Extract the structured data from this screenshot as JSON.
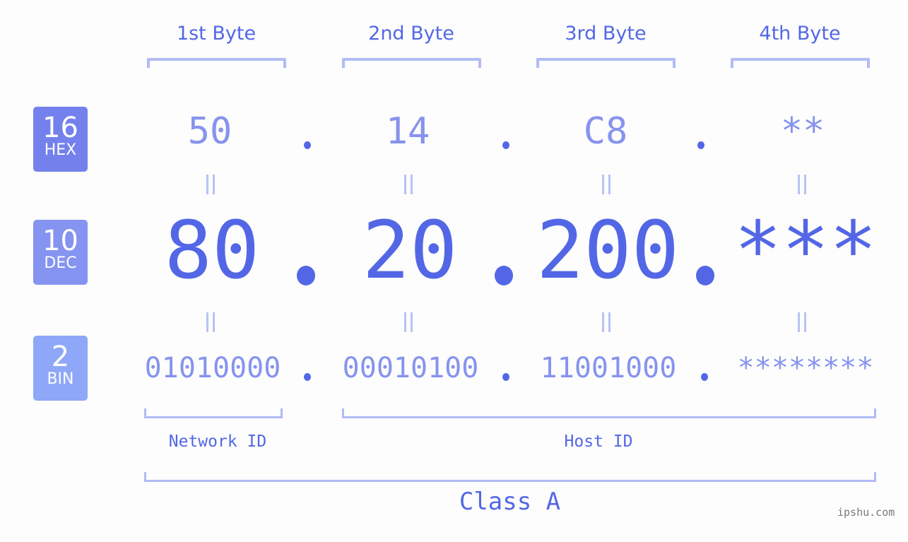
{
  "byte_headers": [
    "1st Byte",
    "2nd Byte",
    "3rd Byte",
    "4th Byte"
  ],
  "badges": {
    "hex": {
      "number": "16",
      "label": "HEX",
      "color": "#7481ec"
    },
    "dec": {
      "number": "10",
      "label": "DEC",
      "color": "#8593f1"
    },
    "bin": {
      "number": "2",
      "label": "BIN",
      "color": "#8fa7f8"
    }
  },
  "hex_values": [
    "50",
    "14",
    "C8",
    "**"
  ],
  "dec_values": [
    "80",
    "20",
    "200",
    "***"
  ],
  "bin_values": [
    "01010000",
    "00010100",
    "11001000",
    "********"
  ],
  "separator": ".",
  "network_id_label": "Network ID",
  "host_id_label": "Host ID",
  "class_label": "Class A",
  "watermark": "ipshu.com",
  "colors": {
    "primary": "#5367e6",
    "secondary": "#8793ee",
    "bracket": "#b1bbf7"
  }
}
